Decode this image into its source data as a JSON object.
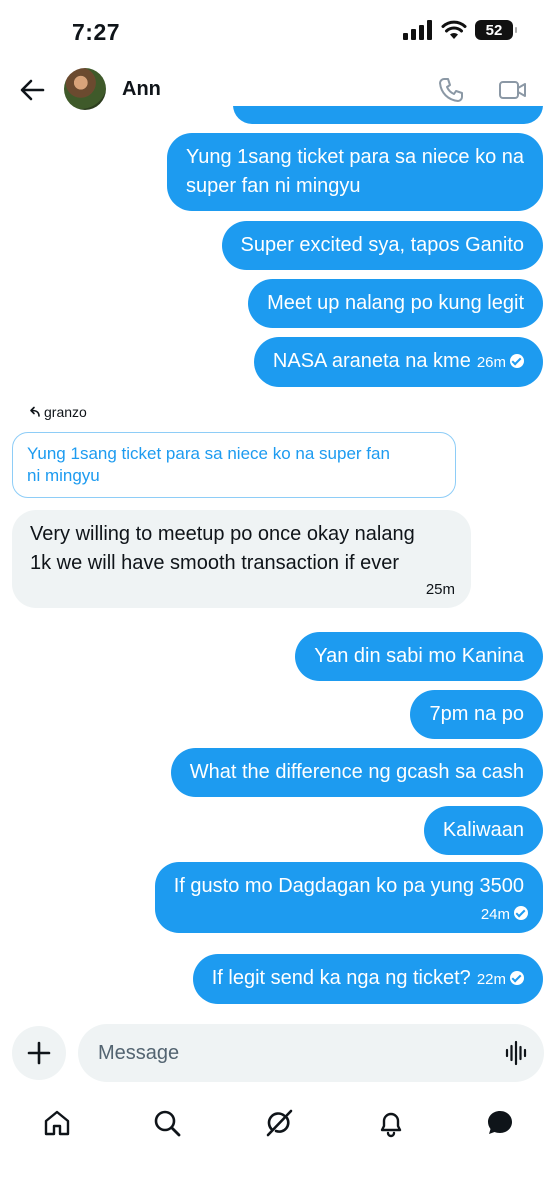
{
  "status": {
    "time": "7:27",
    "battery": "52"
  },
  "header": {
    "name": "Ann"
  },
  "messages_top": [
    {
      "text": "Yung 1sang ticket para sa niece ko na\nsuper fan ni mingyu"
    },
    {
      "text": "Super excited sya, tapos Ganito"
    },
    {
      "text": "Meet up nalang po kung legit"
    },
    {
      "text": "NASA araneta na kme",
      "time": "26m"
    }
  ],
  "reply": {
    "label": "granzo",
    "quoted": "Yung 1sang ticket para sa niece ko na super fan\nni mingyu",
    "text": "Very willing to meetup po once okay nalang\n1k we will have smooth transaction if ever",
    "time": "25m"
  },
  "messages_bottom": [
    {
      "text": "Yan din sabi mo Kanina"
    },
    {
      "text": "7pm na po"
    },
    {
      "text": "What the difference ng gcash sa cash"
    },
    {
      "text": "Kaliwaan"
    },
    {
      "text": "If gusto mo Dagdagan ko pa yung 3500",
      "time": "24m"
    },
    {
      "text": "If legit send ka nga ng ticket?",
      "time": "22m"
    }
  ],
  "composer": {
    "placeholder": "Message"
  },
  "icons": {
    "back": "arrow-left-icon",
    "call": "phone-icon",
    "video": "video-icon",
    "plus": "plus-icon",
    "voice": "waveform-icon",
    "tabs": [
      "home-icon",
      "search-icon",
      "grok-icon",
      "bell-icon",
      "messages-icon"
    ]
  },
  "colors": {
    "accent": "#1d9bf0",
    "incoming_bg": "#eff3f4"
  }
}
